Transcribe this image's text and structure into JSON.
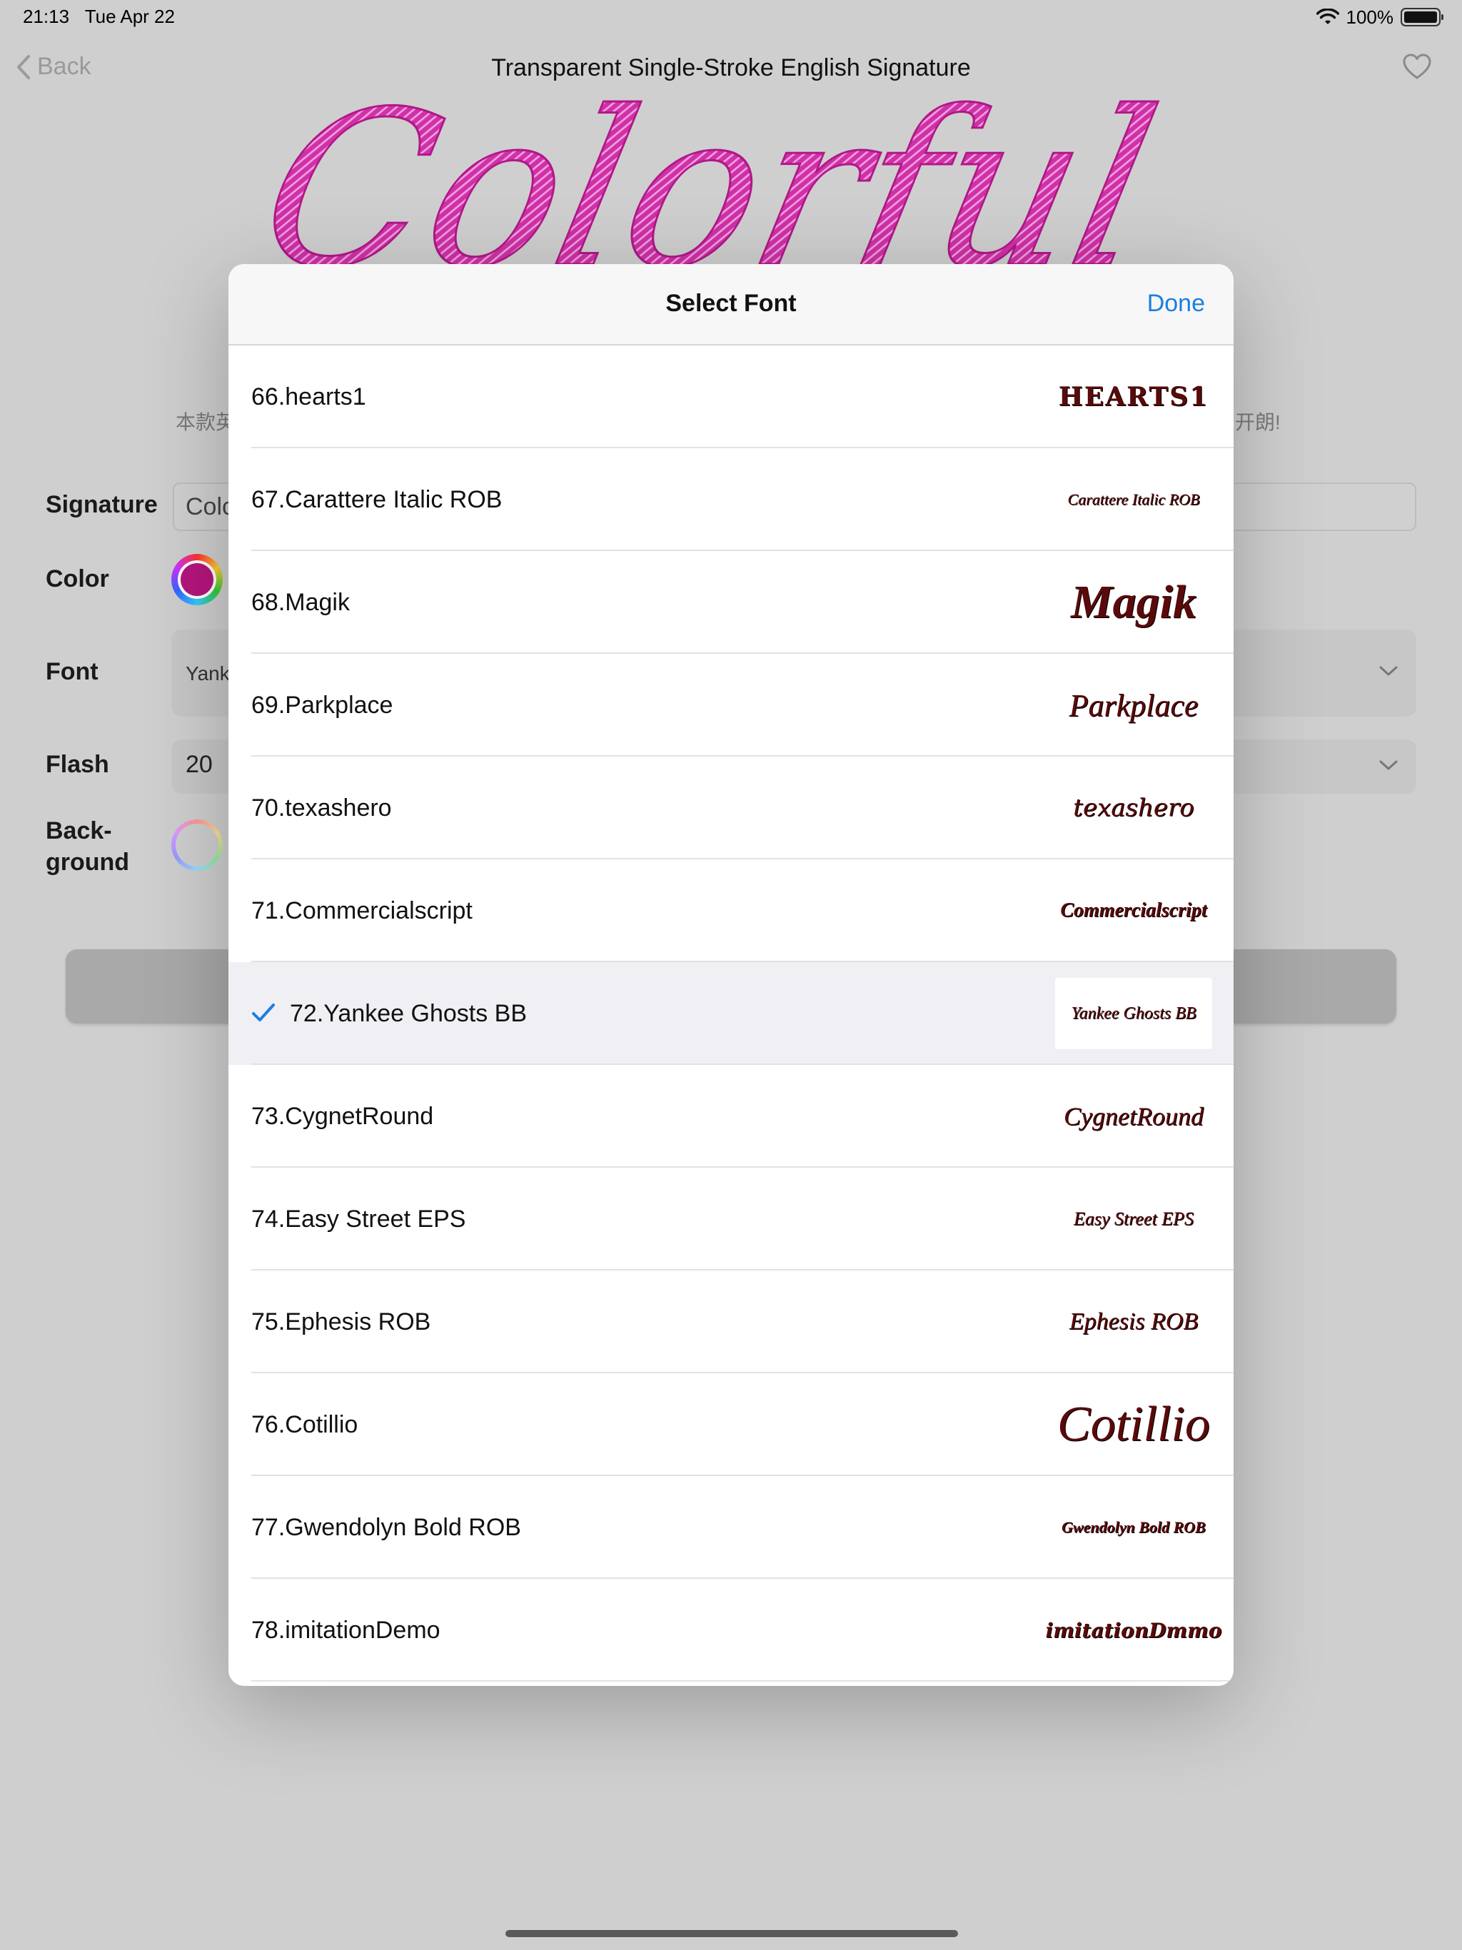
{
  "status": {
    "time": "21:13",
    "date": "Tue Apr 22",
    "battery": "100%"
  },
  "nav": {
    "back": "Back",
    "title": "Transparent Single-Stroke English Signature"
  },
  "preview": {
    "text": "Colorful",
    "color": "#d030a8"
  },
  "hints": {
    "left": "本款英",
    "right": "开朗!"
  },
  "form": {
    "signature_label": "Signature",
    "signature_value": "Colc",
    "color_label": "Color",
    "font_label": "Font",
    "font_value": "Yank",
    "flash_label": "Flash",
    "flash_value": "20",
    "background_label_line1": "Back-",
    "background_label_line2": "ground"
  },
  "modal": {
    "title": "Select Font",
    "done": "Done",
    "items": [
      {
        "label": "66.hearts1",
        "sample": "HEARTS1",
        "selected": false
      },
      {
        "label": "67.Carattere Italic ROB",
        "sample": "Carattere Italic ROB",
        "selected": false
      },
      {
        "label": "68.Magik",
        "sample": "Magik",
        "selected": false
      },
      {
        "label": "69.Parkplace",
        "sample": "Parkplace",
        "selected": false
      },
      {
        "label": "70.texashero",
        "sample": "texashero",
        "selected": false
      },
      {
        "label": "71.Commercialscript",
        "sample": "Commercialscript",
        "selected": false
      },
      {
        "label": "72.Yankee Ghosts BB",
        "sample": "Yankee Ghosts BB",
        "selected": true
      },
      {
        "label": "73.CygnetRound",
        "sample": "CygnetRound",
        "selected": false
      },
      {
        "label": "74.Easy Street EPS",
        "sample": "Easy Street EPS",
        "selected": false
      },
      {
        "label": "75.Ephesis ROB",
        "sample": "Ephesis ROB",
        "selected": false
      },
      {
        "label": "76.Cotillio",
        "sample": "Cotillio",
        "selected": false
      },
      {
        "label": "77.Gwendolyn Bold ROB",
        "sample": "Gwendolyn Bold ROB",
        "selected": false
      },
      {
        "label": "78.imitationDemo",
        "sample": "imitationDmmo",
        "selected": false
      }
    ]
  },
  "colors": {
    "accent": "#1a7fe0",
    "sample_ink": "#5a0a0a",
    "signature_pink": "#d030a8"
  }
}
